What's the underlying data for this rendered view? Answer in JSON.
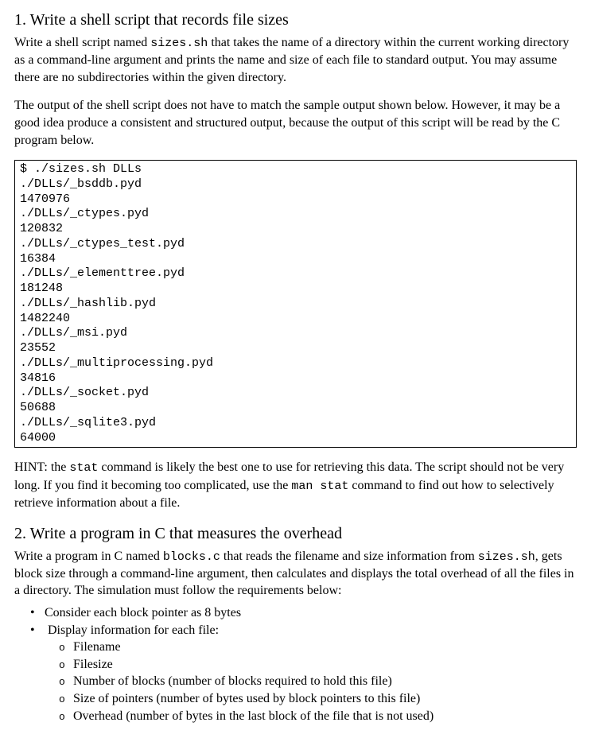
{
  "section1": {
    "heading": "1. Write a shell script that records file sizes",
    "para1_a": "Write a shell script named ",
    "para1_code": "sizes.sh",
    "para1_b": " that takes the name of a directory within the current working directory as a command-line argument and prints the name and size of each file to standard output. You may assume there are no subdirectories within the given directory.",
    "para2": "The output of the shell script does not have to match the sample output shown below. However, it may be a good idea produce a consistent and structured output, because the output of this script will be read by the C program below.",
    "codeblock": "$ ./sizes.sh DLLs\n./DLLs/_bsddb.pyd\n1470976\n./DLLs/_ctypes.pyd\n120832\n./DLLs/_ctypes_test.pyd\n16384\n./DLLs/_elementtree.pyd\n181248\n./DLLs/_hashlib.pyd\n1482240\n./DLLs/_msi.pyd\n23552\n./DLLs/_multiprocessing.pyd\n34816\n./DLLs/_socket.pyd\n50688\n./DLLs/_sqlite3.pyd\n64000",
    "hint_a": "HINT: the ",
    "hint_code1": "stat",
    "hint_b": " command is likely the best one to use for retrieving this data. The script should not be very long. If you find it becoming too complicated, use the ",
    "hint_code2": "man stat",
    "hint_c": " command to find out how to selectively retrieve information about a file."
  },
  "section2": {
    "heading": "2. Write a program in C that measures the overhead",
    "para1_a": "Write a program in C named ",
    "para1_code1": "blocks.c",
    "para1_b": " that reads the filename and size information from ",
    "para1_code2": "sizes.sh",
    "para1_c": ", gets block size through a command-line argument, then calculates and displays the total overhead of all the files in a directory. The simulation must follow the requirements below:",
    "bullets": {
      "b1": "Consider each block pointer as 8 bytes",
      "b2": "Display information for each file:",
      "sub": {
        "s1": "Filename",
        "s2": "Filesize",
        "s3": "Number of blocks (number of blocks required to hold this file)",
        "s4": "Size of pointers (number of bytes used by block pointers to this file)",
        "s5": "Overhead (number of bytes in the last block of the file that is not used)"
      }
    }
  }
}
